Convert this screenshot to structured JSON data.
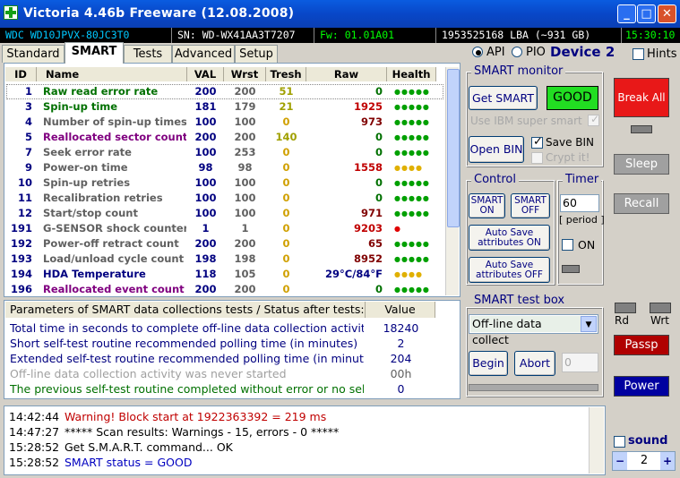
{
  "window": {
    "title": "Victoria 4.46b Freeware (12.08.2008)",
    "minimize": "_",
    "maximize": "□",
    "close": "✕"
  },
  "infobar": {
    "model": "WDC WD10JPVX-80JC3T0",
    "serial": "SN: WD-WX41AA3T7207",
    "firmware": "Fw: 01.01A01",
    "lba": "1953525168 LBA (~931 GB)",
    "time": "15:30:10"
  },
  "tabs": [
    "Standard",
    "SMART",
    "Tests",
    "Advanced",
    "Setup"
  ],
  "device": {
    "api_label": "API",
    "pio_label": "PIO",
    "device_label": "Device 2",
    "hints_label": "Hints"
  },
  "smart_table": {
    "headers": [
      "ID",
      "Name",
      "VAL",
      "Wrst",
      "Tresh",
      "Raw",
      "Health"
    ],
    "rows": [
      {
        "id": "1",
        "name": "Raw read error rate",
        "val": "200",
        "wrst": "200",
        "tresh": "51",
        "raw": "0",
        "health": "●●●●●"
      },
      {
        "id": "3",
        "name": "Spin-up time",
        "val": "181",
        "wrst": "179",
        "tresh": "21",
        "raw": "1925",
        "health": "●●●●●"
      },
      {
        "id": "4",
        "name": "Number of spin-up times",
        "val": "100",
        "wrst": "100",
        "tresh": "0",
        "raw": "973",
        "health": "●●●●●"
      },
      {
        "id": "5",
        "name": "Reallocated sector count",
        "val": "200",
        "wrst": "200",
        "tresh": "140",
        "raw": "0",
        "health": "●●●●●"
      },
      {
        "id": "7",
        "name": "Seek error rate",
        "val": "100",
        "wrst": "253",
        "tresh": "0",
        "raw": "0",
        "health": "●●●●●"
      },
      {
        "id": "9",
        "name": "Power-on time",
        "val": "98",
        "wrst": "98",
        "tresh": "0",
        "raw": "1558",
        "health": "●●●●"
      },
      {
        "id": "10",
        "name": "Spin-up retries",
        "val": "100",
        "wrst": "100",
        "tresh": "0",
        "raw": "0",
        "health": "●●●●●"
      },
      {
        "id": "11",
        "name": "Recalibration retries",
        "val": "100",
        "wrst": "100",
        "tresh": "0",
        "raw": "0",
        "health": "●●●●●"
      },
      {
        "id": "12",
        "name": "Start/stop count",
        "val": "100",
        "wrst": "100",
        "tresh": "0",
        "raw": "971",
        "health": "●●●●●"
      },
      {
        "id": "191",
        "name": "G-SENSOR shock counter",
        "val": "1",
        "wrst": "1",
        "tresh": "0",
        "raw": "9203",
        "health": "●"
      },
      {
        "id": "192",
        "name": "Power-off retract count",
        "val": "200",
        "wrst": "200",
        "tresh": "0",
        "raw": "65",
        "health": "●●●●●"
      },
      {
        "id": "193",
        "name": "Load/unload cycle count",
        "val": "198",
        "wrst": "198",
        "tresh": "0",
        "raw": "8952",
        "health": "●●●●●"
      },
      {
        "id": "194",
        "name": "HDA Temperature",
        "val": "118",
        "wrst": "105",
        "tresh": "0",
        "raw": "29°C/84°F",
        "health": "●●●●"
      },
      {
        "id": "196",
        "name": "Reallocated event count",
        "val": "200",
        "wrst": "200",
        "tresh": "0",
        "raw": "0",
        "health": "●●●●●"
      }
    ]
  },
  "params_table": {
    "header_param": "Parameters of SMART data collections tests / Status after tests:",
    "header_value": "Value",
    "rows": [
      {
        "text": "Total time in seconds to complete off-line data collection activity",
        "value": "18240"
      },
      {
        "text": "Short self-test routine recommended polling time (in minutes)",
        "value": "2"
      },
      {
        "text": "Extended self-test routine recommended polling time (in minutes)",
        "value": "204"
      },
      {
        "text": "Off-line data collection activity was never started",
        "value": "00h"
      },
      {
        "text": "The previous self-test routine completed without error or no self-t...",
        "value": "0"
      }
    ]
  },
  "smart_monitor": {
    "title": "SMART monitor",
    "get_smart": "Get SMART",
    "status": "GOOD",
    "use_ibm": "Use IBM super smart",
    "open_bin": "Open BIN",
    "save_bin": "Save BIN",
    "crypt_it": "Crypt it!"
  },
  "control": {
    "title": "Control",
    "smart_on": "SMART ON",
    "smart_off": "SMART OFF",
    "autosave_on": "Auto Save attributes ON",
    "autosave_off": "Auto Save attributes OFF"
  },
  "timer": {
    "title": "Timer",
    "value": "60",
    "period": "[ period ]",
    "on_label": "ON"
  },
  "test_box": {
    "title": "SMART test box",
    "selected": "Off-line data collect",
    "begin": "Begin",
    "abort": "Abort",
    "value": "0"
  },
  "right_panel": {
    "break_all": "Break All",
    "sleep": "Sleep",
    "recall": "Recall",
    "rd": "Rd",
    "wrt": "Wrt",
    "passp": "Passp",
    "power": "Power",
    "sound": "sound",
    "spinner_value": "2",
    "minus": "−",
    "plus": "+"
  },
  "log": [
    {
      "time": "14:42:44",
      "msg": "Warning! Block start at 1922363392 = 219 ms"
    },
    {
      "time": "14:47:27",
      "msg": "***** Scan results: Warnings - 15, errors - 0 *****"
    },
    {
      "time": "15:28:52",
      "msg": "Get S.M.A.R.T. command... OK"
    },
    {
      "time": "15:28:52",
      "msg": "SMART status = GOOD"
    }
  ],
  "colors": {
    "green_text": "#007000",
    "purple_text": "#800080",
    "gray_text": "#808080",
    "blue_text": "#000080",
    "good_bg": "#22dd22",
    "break_bg": "#e81818",
    "passp_bg": "#b00000",
    "power_bg": "#0000a0"
  }
}
